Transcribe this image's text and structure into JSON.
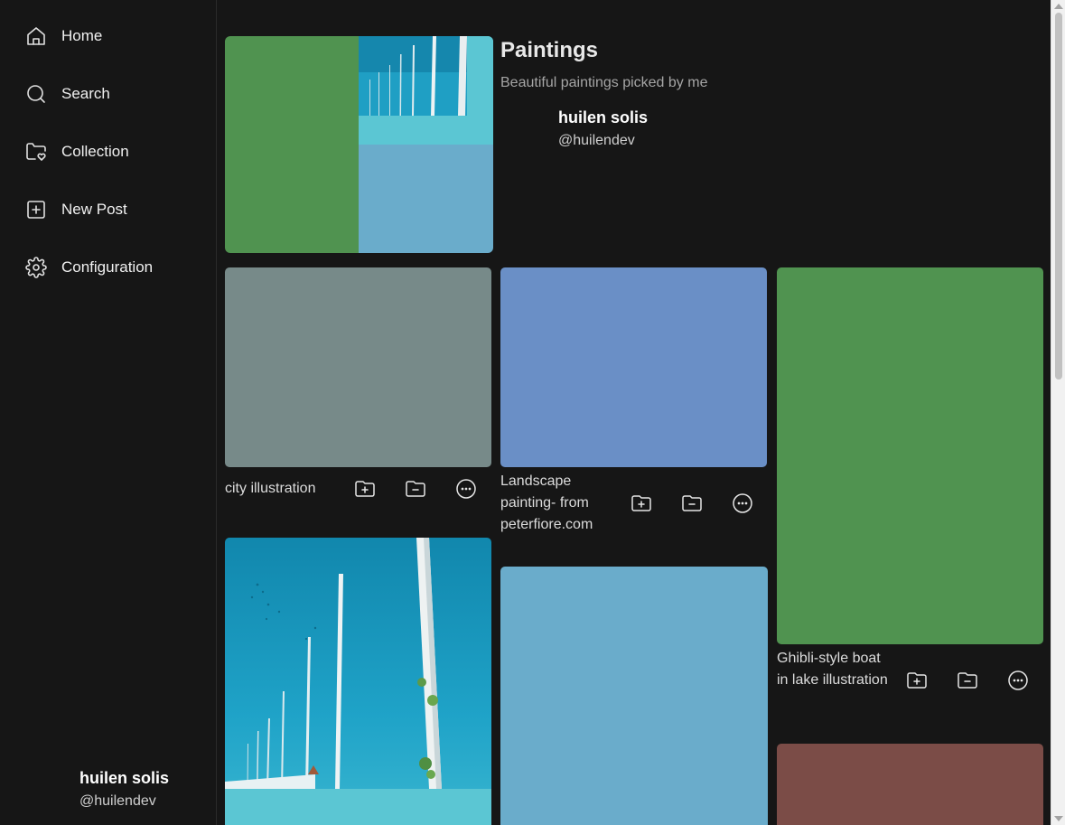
{
  "sidebar": {
    "items": [
      {
        "label": "Home",
        "icon": "home-icon"
      },
      {
        "label": "Search",
        "icon": "search-icon"
      },
      {
        "label": "Collection",
        "icon": "folder-heart-icon"
      },
      {
        "label": "New Post",
        "icon": "plus-square-icon"
      },
      {
        "label": "Configuration",
        "icon": "gear-icon"
      }
    ],
    "user": {
      "name": "huilen solis",
      "handle": "@huilendev"
    }
  },
  "collection": {
    "title": "Paintings",
    "description": "Beautiful paintings picked by me",
    "owner": {
      "name": "huilen solis",
      "handle": "@huilendev"
    }
  },
  "posts": [
    {
      "caption": "city illustration",
      "color": "#778a89"
    },
    {
      "caption": "Landscape painting- from peterfiore.com",
      "color": "#6a8fc6"
    },
    {
      "caption": "Ghibli-style boat in lake illustration",
      "color": "#509350"
    },
    {
      "caption": "",
      "color": "#0f8fb5"
    },
    {
      "caption": "",
      "color": "#6aaccb"
    },
    {
      "caption": "",
      "color": "#7b4c47"
    }
  ],
  "cover_colors": [
    "#509350",
    "#1ea7c9",
    "#6aaccb"
  ],
  "colors": {
    "background": "#161616",
    "text": "#e6e6e6",
    "muted": "#a5a5a5"
  }
}
